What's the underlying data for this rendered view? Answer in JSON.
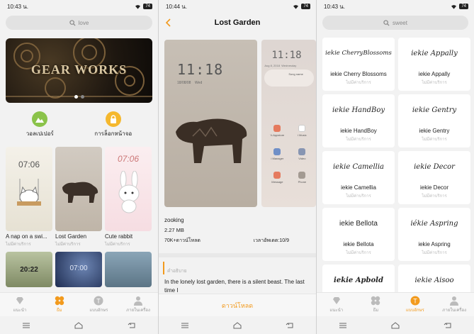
{
  "status": {
    "left_time": "10:43 น.",
    "middle_time": "10:44 น.",
    "right_time": "10:43 น.",
    "battery": "74"
  },
  "left": {
    "search_placeholder": "love",
    "banner_text": "GEAR WORKS",
    "quick": [
      {
        "label": "วอลเปเปอร์",
        "icon": "mountain-icon",
        "color": "#8bc34a"
      },
      {
        "label": "การล็อกหน้าจอ",
        "icon": "lock-icon",
        "color": "#f5b82e"
      }
    ],
    "themes": [
      {
        "title": "A nap on a swi...",
        "sub": "ไม่มีค่าบริการ",
        "clock": "07:06"
      },
      {
        "title": "Lost Garden",
        "sub": "ไม่มีค่าบริการ",
        "clock": ""
      },
      {
        "title": "Cute rabbit",
        "sub": "ไม่มีค่าบริการ",
        "clock": "07:06"
      }
    ],
    "more": [
      {
        "clock": "20:22"
      },
      {
        "clock": "07:00"
      },
      {
        "clock": ""
      }
    ]
  },
  "nav": {
    "items": [
      "แนะนำ",
      "ธีม",
      "แบบอักษร",
      "ภายในเครื่อง"
    ],
    "accent": "#f29a1d"
  },
  "middle": {
    "title": "Lost Garden",
    "preview_clock": "11:18",
    "preview_date": "18/08/08",
    "preview_day": "Wed",
    "preview2_clock": "11:18",
    "preview2_date": "Aug 8, 2018",
    "preview2_day": "Wednesday",
    "song_name": "Song name",
    "apps": [
      "V-Appstore",
      "i Music",
      "i Manager",
      "Video",
      "Message",
      "Phone"
    ],
    "author": "zooking",
    "size": "2.27 MB",
    "downloads": "70K+ดาวน์โหลด",
    "rating": "เวลาอัพเดต:10/9",
    "desc_label": "คำอธิบาย",
    "desc_text": "In the lonely lost garden, there is a silent beast. The last time I",
    "download_btn": "ดาวน์โหลด"
  },
  "right": {
    "search_placeholder": "sweet",
    "fonts": [
      {
        "sample": "iekie CherryBlossoms",
        "name": "iekie Cherry Blossoms",
        "sub": "ไม่มีค่าบริการ"
      },
      {
        "sample": "iekie Appally",
        "name": "iekie Appally",
        "sub": "ไม่มีค่าบริการ"
      },
      {
        "sample": "iekie HandBoy",
        "name": "iekie HandBoy",
        "sub": "ไม่มีค่าบริการ"
      },
      {
        "sample": "iekie Gentry",
        "name": "iekie Gentry",
        "sub": "ไม่มีค่าบริการ"
      },
      {
        "sample": "iekie Camellia",
        "name": "iekie Camellia",
        "sub": "ไม่มีค่าบริการ"
      },
      {
        "sample": "iekie Decor",
        "name": "iekie Decor",
        "sub": "ไม่มีค่าบริการ"
      },
      {
        "sample": "iekie Bellota",
        "name": "iekie Bellota",
        "sub": "ไม่มีค่าบริการ"
      },
      {
        "sample": "iékie Aspring",
        "name": "iekie Aspring",
        "sub": "ไม่มีค่าบริการ"
      },
      {
        "sample": "iekie Apbold",
        "name": "",
        "sub": ""
      },
      {
        "sample": "iekie Aisoo",
        "name": "",
        "sub": ""
      }
    ]
  }
}
